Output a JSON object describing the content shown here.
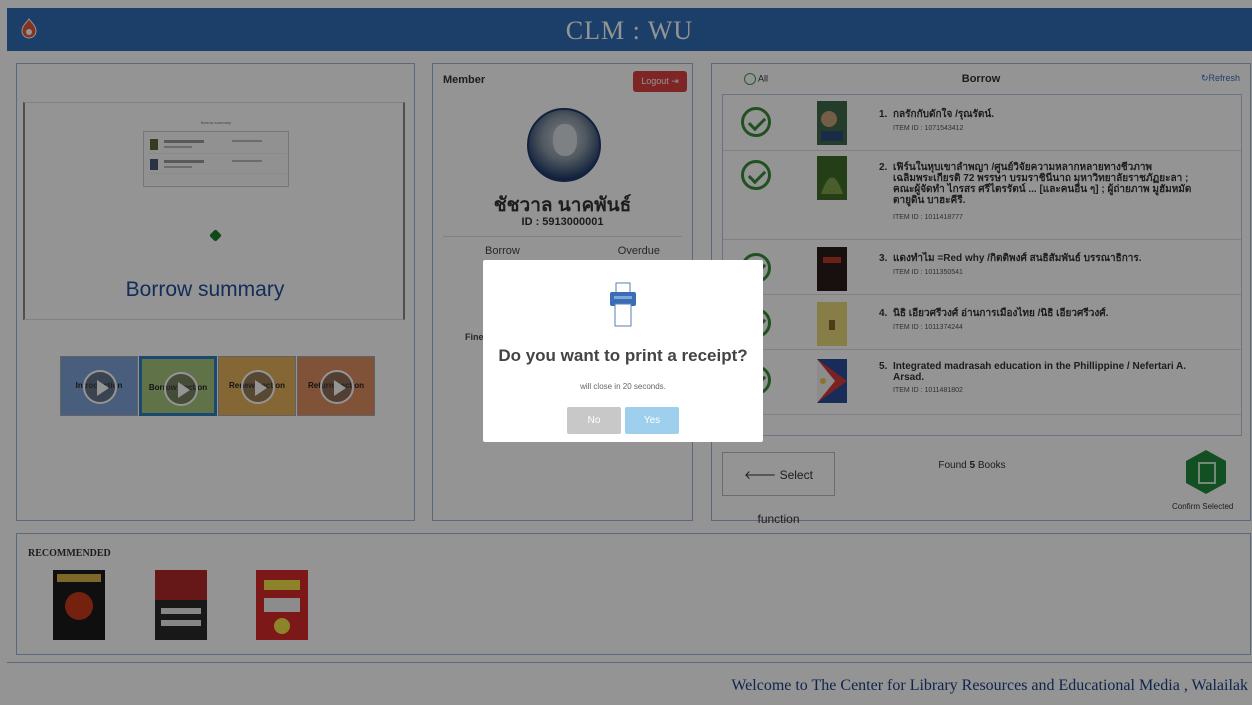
{
  "header": {
    "title": "CLM : WU"
  },
  "left": {
    "headline": "Borrow summary",
    "mini_caption": "Borrow summary",
    "tiles": [
      "Introduction",
      "Borrow section",
      "Renew section",
      "Return section"
    ]
  },
  "member": {
    "heading": "Member",
    "logout_label": "Logout",
    "name": "ชัชวาล นาคพันธ์",
    "id_text": "ID : 5913000001",
    "tab_borrow": "Borrow",
    "tab_overdue": "Overdue",
    "fine_label": "Fine"
  },
  "borrow": {
    "all_label": "All",
    "title": "Borrow",
    "refresh_label": "Refresh",
    "items": [
      {
        "num": "1.",
        "title": "กลรักกับดักใจ /รุณรัตน์.",
        "item_id": "ITEM ID : 1071543412"
      },
      {
        "num": "2.",
        "title": "เฟิร์นในหุบเขาลำพญา /ศูนย์วิจัยความหลากหลายทางชีวภาพ เฉลิมพระเกียรติ 72 พรรษา บรมราชินีนาถ มหาวิทยาลัยราชภัฏยะลา ; คณะผู้จัดทำ ไกรสร ศรีไตรรัตน์ ... [และคนอื่น ๆ] ; ผู้ถ่ายภาพ มูฮัมหมัดตายูดิน บาฮะคีรี.",
        "item_id": "ITEM ID : 1011418777"
      },
      {
        "num": "3.",
        "title": "แดงทำไม =Red why /กิตติพงศ์ สนธิสัมพันธ์ บรรณาธิการ.",
        "item_id": "ITEM ID : 1011350541"
      },
      {
        "num": "4.",
        "title": "นิธิ เอียวศรีวงศ์ อ่านการเมืองไทย /นิธิ เอียวศรีวงศ์.",
        "item_id": "ITEM ID : 1011374244"
      },
      {
        "num": "5.",
        "title": "Integrated madrasah education in the Phillippine / Nefertari A. Arsad.",
        "item_id": "ITEM ID : 1011481802"
      }
    ],
    "select_function": "Select function",
    "found_prefix": "Found",
    "found_count": "5",
    "found_suffix": "Books",
    "confirm_label": "Confirm Selected"
  },
  "recommended": {
    "title": "RECOMMENDED"
  },
  "footer": {
    "text": "Welcome to The Center for Library Resources and Educational Media , Walailak"
  },
  "modal": {
    "question": "Do you want to print a receipt?",
    "countdown": "will close in 20 seconds.",
    "no_label": "No",
    "yes_label": "Yes"
  },
  "colors": {
    "header": "#2f6db5",
    "success": "#3a8a3a",
    "logout": "#d94040",
    "yes": "#9ed0ee"
  }
}
